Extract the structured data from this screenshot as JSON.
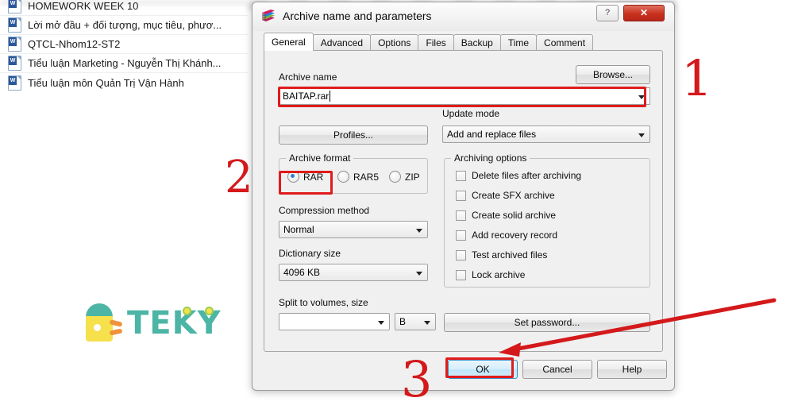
{
  "background": {
    "files": [
      {
        "name": "HOMEWORK WEEK 10",
        "icon": "word-doc-icon"
      },
      {
        "name": "Lời mở đầu + đối tượng, mục tiêu, phươ...",
        "icon": "word-doc-icon"
      },
      {
        "name": "QTCL-Nhom12-ST2",
        "icon": "word-doc-icon"
      },
      {
        "name": "Tiểu luận Marketing - Nguyễn Thị Khánh...",
        "icon": "word-doc-icon"
      },
      {
        "name": "Tiểu luận môn Quản Trị Vận Hành",
        "icon": "word-doc-icon"
      }
    ]
  },
  "watermark": {
    "brand": "TEKY",
    "colors": {
      "teal": "#4cb5a5",
      "yellow": "#f6e04b",
      "orange": "#f0923c",
      "green": "#9ccf4e"
    }
  },
  "dialog": {
    "title": "Archive name and parameters",
    "icon": "winrar-books-icon",
    "help_button": "?",
    "close_button": "✕",
    "tabs": [
      {
        "label": "General",
        "active": true
      },
      {
        "label": "Advanced",
        "active": false
      },
      {
        "label": "Options",
        "active": false
      },
      {
        "label": "Files",
        "active": false
      },
      {
        "label": "Backup",
        "active": false
      },
      {
        "label": "Time",
        "active": false
      },
      {
        "label": "Comment",
        "active": false
      }
    ],
    "archive_name": {
      "label": "Archive name",
      "value": "BAITAP.rar",
      "browse_label": "Browse..."
    },
    "profiles_label": "Profiles...",
    "update_mode": {
      "label": "Update mode",
      "value": "Add and replace files"
    },
    "archive_format": {
      "label": "Archive format",
      "options": [
        {
          "label": "RAR",
          "selected": true
        },
        {
          "label": "RAR5",
          "selected": false
        },
        {
          "label": "ZIP",
          "selected": false
        }
      ]
    },
    "compression_method": {
      "label": "Compression method",
      "value": "Normal"
    },
    "dictionary_size": {
      "label": "Dictionary size",
      "value": "4096 KB"
    },
    "split_volumes": {
      "label": "Split to volumes, size",
      "value": "",
      "unit": "B"
    },
    "archiving_options": {
      "label": "Archiving options",
      "items": [
        {
          "label": "Delete files after archiving",
          "checked": false
        },
        {
          "label": "Create SFX archive",
          "checked": false
        },
        {
          "label": "Create solid archive",
          "checked": false
        },
        {
          "label": "Add recovery record",
          "checked": false
        },
        {
          "label": "Test archived files",
          "checked": false
        },
        {
          "label": "Lock archive",
          "checked": false
        }
      ]
    },
    "set_password_label": "Set password...",
    "buttons": {
      "ok": "OK",
      "cancel": "Cancel",
      "help": "Help"
    }
  },
  "annotations": {
    "accent_color": "#d4191b",
    "steps": [
      {
        "number": "1",
        "target": "archive-name-input"
      },
      {
        "number": "2",
        "target": "archive-format-rar-radio"
      },
      {
        "number": "3",
        "target": "ok-button"
      }
    ],
    "arrow": {
      "points_to": "ok-button"
    }
  }
}
